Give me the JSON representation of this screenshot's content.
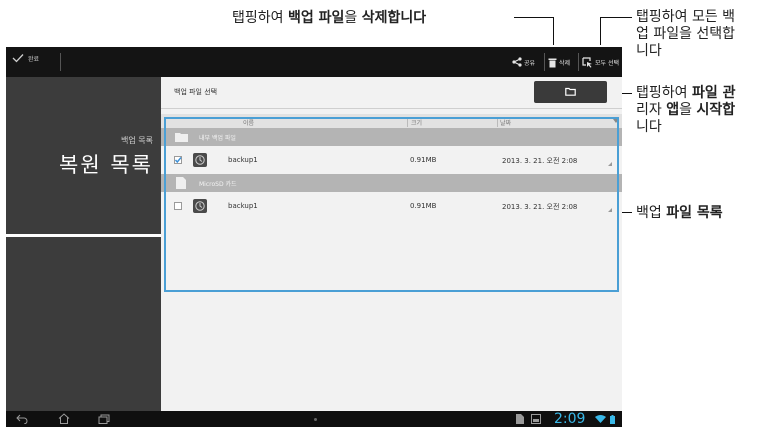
{
  "callouts": {
    "delete": {
      "pre": "탭핑하여 ",
      "bold1": "백업 파일",
      "mid": "을 ",
      "bold2": "삭제합니다"
    },
    "select_all": {
      "line1": "탭핑하여 모든 백",
      "line2": "업 파일을 선택합",
      "line3": "니다"
    },
    "file_manager": {
      "line1_pre": "탭핑하여 ",
      "line1_bold": "파일 관",
      "line2_pre": "리자 ",
      "line2_bold1": "앱",
      "line2_mid": "을 ",
      "line2_bold2": "시작합",
      "line3": "니다"
    },
    "file_list": {
      "pre": "백업 ",
      "bold": "파일 목록"
    }
  },
  "actionbar": {
    "done_label": "완료",
    "share_label": "공유",
    "delete_label": "삭제",
    "select_all_label": "모두 선택"
  },
  "left_panel": {
    "subtitle": "백업 목록",
    "title": "복원 목록"
  },
  "content": {
    "title": "백업 파일 선택",
    "columns": {
      "name": "이름",
      "size": "크기",
      "date": "날짜"
    },
    "groups": [
      {
        "label": "내부 백업 파일",
        "files": [
          {
            "name": "backup1",
            "size": "0.91MB",
            "date": "2013. 3. 21. 오전 2:08",
            "checked": true
          }
        ]
      },
      {
        "label": "MicroSD 카드",
        "files": [
          {
            "name": "backup1",
            "size": "0.91MB",
            "date": "2013. 3. 21. 오전 2:08",
            "checked": false
          }
        ]
      }
    ]
  },
  "statusbar": {
    "time": "2:09"
  },
  "colors": {
    "accent": "#39b8e8",
    "highlight": "#4a9fd5",
    "check": "#3b8fd6"
  }
}
